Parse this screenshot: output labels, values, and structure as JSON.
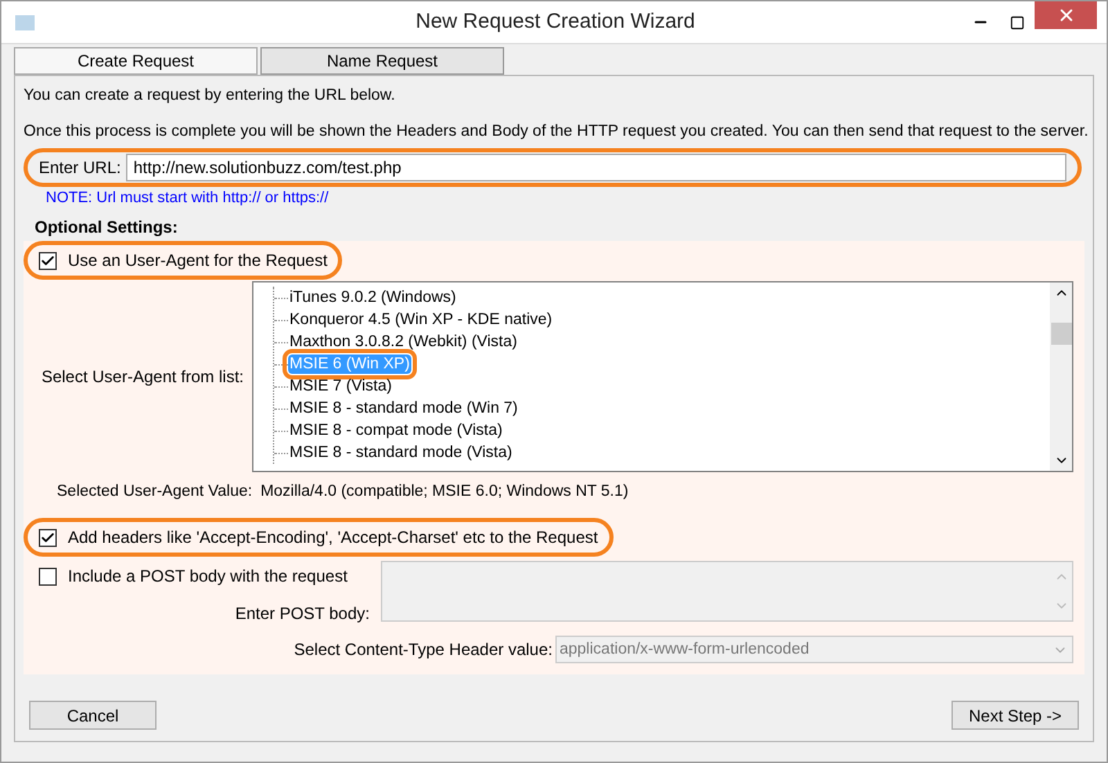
{
  "window": {
    "title": "New Request Creation Wizard"
  },
  "tabs": [
    {
      "label": "Create Request",
      "selected": true
    },
    {
      "label": "Name Request",
      "selected": false
    }
  ],
  "intro": "You can create a request by entering the URL below.",
  "info": "Once this process is complete you will be shown the Headers and Body of the HTTP request you created. You can then send that request to the server.",
  "url": {
    "label": "Enter URL:",
    "value": "http://new.solutionbuzz.com/test.php",
    "note": "NOTE: Url must start with http:// or https://",
    "highlighted": true
  },
  "optional_settings": {
    "heading": "Optional Settings:",
    "use_user_agent": {
      "label": "Use an User-Agent for the Request",
      "checked": true,
      "highlighted": true
    },
    "user_agent_list": {
      "label": "Select User-Agent from list:",
      "items": [
        {
          "label": "iTunes 9.0.2 (Windows)",
          "selected": false,
          "highlighted": false
        },
        {
          "label": "Konqueror 4.5 (Win XP - KDE native)",
          "selected": false,
          "highlighted": false
        },
        {
          "label": "Maxthon 3.0.8.2 (Webkit) (Vista)",
          "selected": false,
          "highlighted": false
        },
        {
          "label": "MSIE 6 (Win XP)",
          "selected": true,
          "highlighted": true
        },
        {
          "label": "MSIE 7 (Vista)",
          "selected": false,
          "highlighted": false
        },
        {
          "label": "MSIE 8 - standard mode (Win 7)",
          "selected": false,
          "highlighted": false
        },
        {
          "label": "MSIE 8 - compat mode (Vista)",
          "selected": false,
          "highlighted": false
        },
        {
          "label": "MSIE 8 - standard mode (Vista)",
          "selected": false,
          "highlighted": false
        }
      ]
    },
    "selected_value": {
      "label": "Selected User-Agent Value:",
      "value": "Mozilla/4.0 (compatible; MSIE 6.0; Windows NT 5.1)"
    },
    "add_headers": {
      "label": "Add headers like 'Accept-Encoding', 'Accept-Charset' etc to the Request",
      "checked": true,
      "highlighted": true
    },
    "post_body": {
      "label": "Include a POST body with the request",
      "checked": false
    },
    "post_body_field": {
      "label": "Enter POST body:",
      "disabled": true
    },
    "content_type": {
      "label": "Select Content-Type Header value:",
      "value": "application/x-www-form-urlencoded",
      "disabled": true
    }
  },
  "buttons": {
    "cancel": "Cancel",
    "next": "Next Step ->"
  }
}
